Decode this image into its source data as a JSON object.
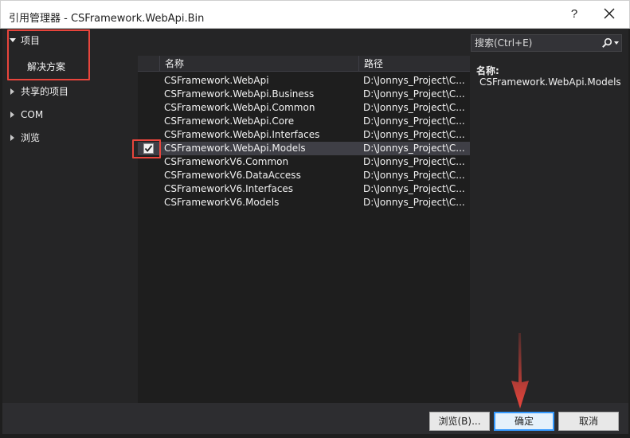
{
  "window": {
    "title": "引用管理器 - CSFramework.WebApi.Bin",
    "help": "?"
  },
  "nav": {
    "items": [
      {
        "label": "项目",
        "expanded": true
      },
      {
        "label": "解决方案",
        "child": true
      },
      {
        "label": "共享的项目",
        "expanded": false
      },
      {
        "label": "COM",
        "expanded": false
      },
      {
        "label": "浏览",
        "expanded": false
      }
    ]
  },
  "list": {
    "columns": {
      "name": "名称",
      "path": "路径"
    },
    "rows": [
      {
        "name": "CSFramework.WebApi",
        "path": "D:\\Jonnys_Project\\C...",
        "checked": false
      },
      {
        "name": "CSFramework.WebApi.Business",
        "path": "D:\\Jonnys_Project\\C...",
        "checked": false
      },
      {
        "name": "CSFramework.WebApi.Common",
        "path": "D:\\Jonnys_Project\\C...",
        "checked": false
      },
      {
        "name": "CSFramework.WebApi.Core",
        "path": "D:\\Jonnys_Project\\C...",
        "checked": false
      },
      {
        "name": "CSFramework.WebApi.Interfaces",
        "path": "D:\\Jonnys_Project\\C...",
        "checked": false
      },
      {
        "name": "CSFramework.WebApi.Models",
        "path": "D:\\Jonnys_Project\\C...",
        "checked": true
      },
      {
        "name": "CSFrameworkV6.Common",
        "path": "D:\\Jonnys_Project\\C...",
        "checked": false
      },
      {
        "name": "CSFrameworkV6.DataAccess",
        "path": "D:\\Jonnys_Project\\C...",
        "checked": false
      },
      {
        "name": "CSFrameworkV6.Interfaces",
        "path": "D:\\Jonnys_Project\\C...",
        "checked": false
      },
      {
        "name": "CSFrameworkV6.Models",
        "path": "D:\\Jonnys_Project\\C...",
        "checked": false
      }
    ]
  },
  "search": {
    "placeholder": "搜索(Ctrl+E)"
  },
  "detail": {
    "label": "名称:",
    "value": "CSFramework.WebApi.Models"
  },
  "buttons": {
    "browse": "浏览(B)...",
    "ok": "确定",
    "cancel": "取消"
  },
  "colors": {
    "accent": "#3399ff",
    "highlight": "#e8453c",
    "selected_row": "#3f3f46"
  }
}
